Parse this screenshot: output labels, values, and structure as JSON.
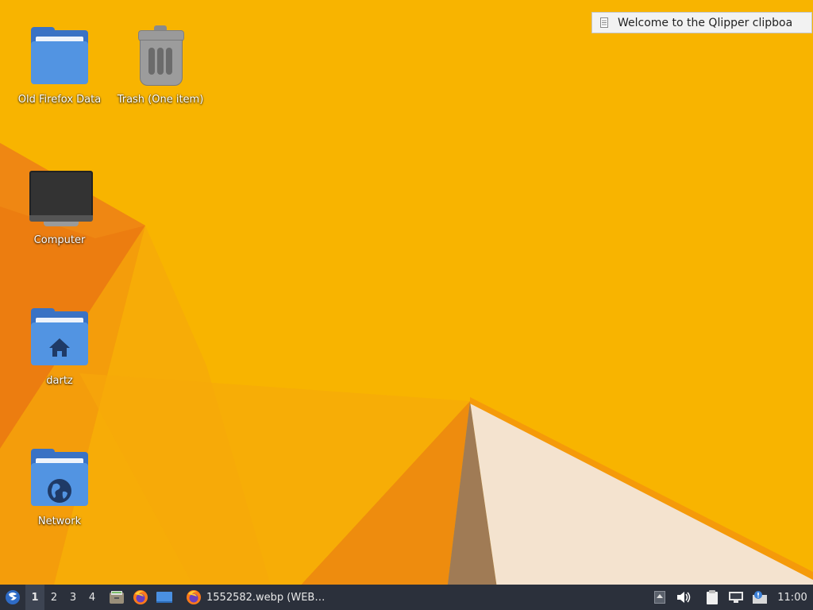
{
  "desktop": {
    "icons": [
      {
        "label": "Old Firefox Data",
        "icon": "folder-icon"
      },
      {
        "label": "Trash (One item)",
        "icon": "trash-icon"
      },
      {
        "label": "Computer",
        "icon": "computer-icon"
      },
      {
        "label": "dartz",
        "icon": "home-folder-icon"
      },
      {
        "label": "Network",
        "icon": "network-folder-icon"
      }
    ]
  },
  "notification": {
    "text": "Welcome to the Qlipper clipboa",
    "icon": "document-icon"
  },
  "taskbar": {
    "start_icon": "lxqt-start-icon",
    "desktops": [
      "1",
      "2",
      "3",
      "4"
    ],
    "active_desktop": "1",
    "quicklaunch": [
      "file-manager-icon",
      "firefox-icon",
      "show-desktop-icon"
    ],
    "tasks": [
      {
        "title": "1552582.webp (WEB…",
        "icon": "firefox-icon"
      }
    ],
    "tray": [
      "tray-expand-icon",
      "volume-icon",
      "clipboard-icon",
      "network-monitor-icon",
      "update-notifier-icon"
    ],
    "clock": "11:00"
  },
  "colors": {
    "wallpaper_base": "#f8b200",
    "wallpaper_dark": "#e8750a",
    "wallpaper_light": "#f5e4cf",
    "taskbar_bg": "#2b303b",
    "folder_blue": "#5294e2"
  }
}
